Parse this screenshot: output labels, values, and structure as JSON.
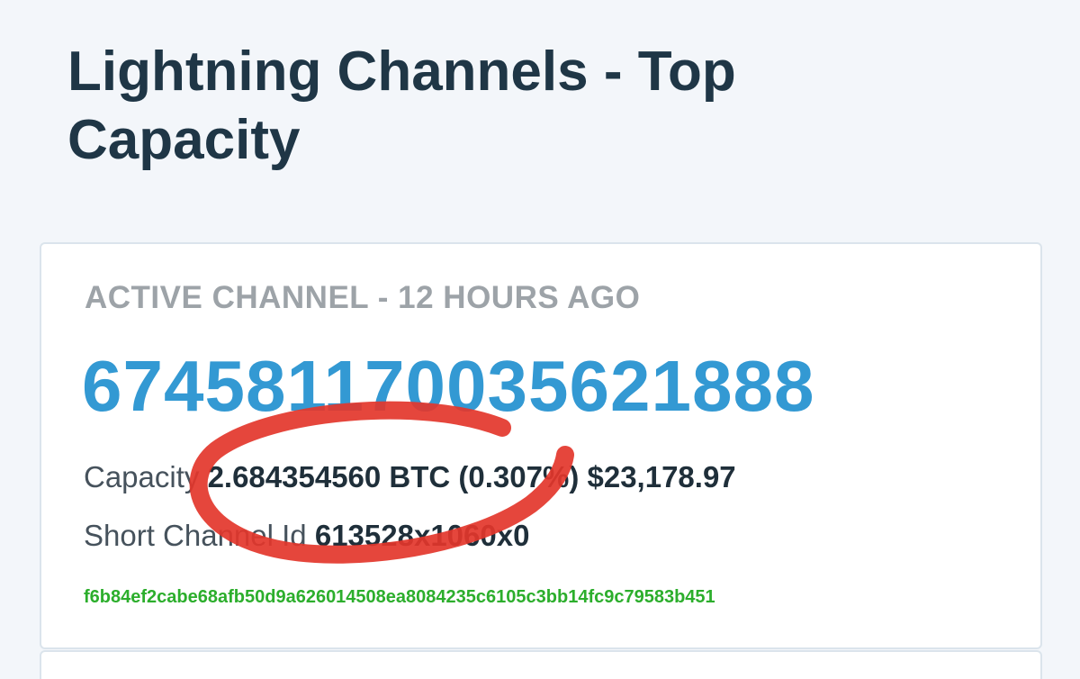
{
  "page": {
    "title": "Lightning Channels - Top Capacity"
  },
  "channel": {
    "status": "ACTIVE CHANNEL - 12 HOURS AGO",
    "id": "674581170035621888",
    "capacity_label": "Capacity",
    "capacity_value": "2.684354560 BTC (0.307%) $23,178.97",
    "short_id_label": "Short Channel Id",
    "short_id_value": "613528x1060x0",
    "txid": "f6b84ef2cabe68afb50d9a626014508ea8084235c6105c3bb14fc9c79583b451"
  },
  "colors": {
    "title": "#1f3646",
    "channel_id": "#3399d3",
    "txid": "#2cae2c",
    "annotation": "#e3362b"
  }
}
